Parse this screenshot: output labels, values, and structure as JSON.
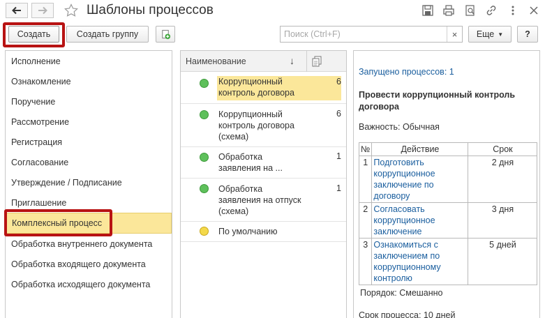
{
  "window": {
    "title": "Шаблоны процессов"
  },
  "toolbar": {
    "create_label": "Создать",
    "create_group_label": "Создать группу",
    "search_placeholder": "Поиск (Ctrl+F)",
    "search_clear": "×",
    "more_label": "Еще",
    "help_label": "?"
  },
  "sidebar": {
    "items": [
      {
        "label": "Исполнение"
      },
      {
        "label": "Ознакомление"
      },
      {
        "label": "Поручение"
      },
      {
        "label": "Рассмотрение"
      },
      {
        "label": "Регистрация"
      },
      {
        "label": "Согласование"
      },
      {
        "label": "Утверждение / Подписание"
      },
      {
        "label": "Приглашение"
      },
      {
        "label": "Комплексный процесс"
      },
      {
        "label": "Обработка внутреннего документа"
      },
      {
        "label": "Обработка входящего документа"
      },
      {
        "label": "Обработка исходящего документа"
      }
    ]
  },
  "list": {
    "column_name": "Наименование",
    "sort_arrow": "↓",
    "rows": [
      {
        "name": "Коррупционный контроль договора",
        "count": "6",
        "status": "green"
      },
      {
        "name": "Коррупционный контроль договора (схема)",
        "count": "6",
        "status": "green"
      },
      {
        "name": "Обработка заявления на ...",
        "count": "1",
        "status": "green"
      },
      {
        "name": "Обработка заявления на отпуск (схема)",
        "count": "1",
        "status": "green"
      },
      {
        "name": "По умолчанию",
        "count": "",
        "status": "yellow"
      }
    ]
  },
  "details": {
    "launched": "Запущено процессов: 1",
    "heading": "Провести коррупционный контроль договора",
    "importance_label": "Важность:",
    "importance_value": "Обычная",
    "table": {
      "col_num": "№",
      "col_action": "Действие",
      "col_term": "Срок",
      "rows": [
        {
          "num": "1",
          "action": "Подготовить коррупционное заключение по договору",
          "term": "2 дня"
        },
        {
          "num": "2",
          "action": "Согласовать коррупционное заключение",
          "term": "3 дня"
        },
        {
          "num": "3",
          "action": "Ознакомиться с заключением по коррупционному контролю",
          "term": "5 дней"
        }
      ]
    },
    "order_label": "Порядок:",
    "order_value": "Смешанно",
    "duration": "Срок процесса: 10 дней"
  },
  "colors": {
    "selection": "#fbe79a",
    "highlight_frame": "#b81313",
    "link": "#1a5e9e",
    "status_green": "#5ec05b",
    "status_yellow": "#f4d94a"
  }
}
